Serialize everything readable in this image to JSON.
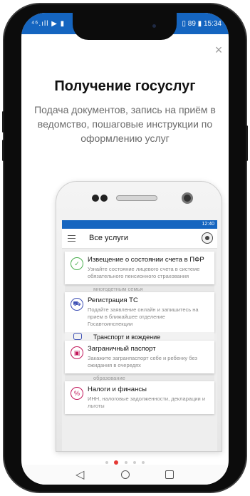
{
  "status_bar": {
    "left": "⁴⁶.ıll ▶ ▮",
    "right": "▯ 89 ▮ 15:34"
  },
  "onboarding": {
    "close_symbol": "×",
    "title": "Получение госуслуг",
    "subtitle": "Подача документов, запись на приём в ведомство, пошаговые инструкции по оформлению услуг"
  },
  "mock_screen": {
    "status_time": "12:40",
    "title": "Все услуги",
    "cards": [
      {
        "title": "Извещение о состоянии счета в ПФР",
        "desc": "Узнайте состояние лицевого счета в системе обязательного пенсионного страхования",
        "icon": "document-check-icon",
        "color": "#4caf50"
      },
      {
        "title": "Регистрация ТС",
        "desc": "Подайте заявление онлайн и запишитесь на прием в ближайшее отделение Госавтоинспекции",
        "icon": "car-icon",
        "color": "#3f51b5"
      },
      {
        "title": "Заграничный паспорт",
        "desc": "Закажите загранпаспорт себе и ребенку без ожидания в очередях",
        "icon": "passport-icon",
        "color": "#c2185b"
      },
      {
        "title": "Налоги и финансы",
        "desc": "ИНН, налоговые задолженности, декларации и льготы",
        "icon": "tax-icon",
        "color": "#c2185b"
      }
    ],
    "gap_labels": [
      "многодетным семья",
      "образование"
    ],
    "peek_item": "Транспорт и вождение"
  },
  "pager": {
    "count": 5,
    "active_index": 1
  },
  "colors": {
    "brand": "#1565c0",
    "accent": "#e53935"
  },
  "nav_icons": [
    "back-icon",
    "home-icon",
    "recent-apps-icon"
  ]
}
